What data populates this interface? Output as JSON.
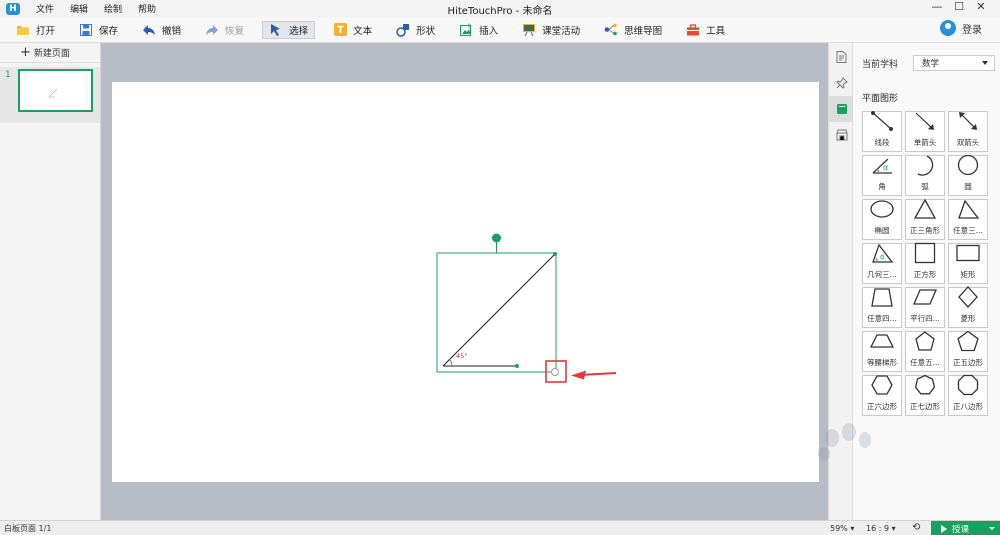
{
  "titlebar": {
    "title": "HiteTouchPro - 未命名",
    "menu": [
      "文件",
      "编辑",
      "绘制",
      "帮助"
    ]
  },
  "toolbar": {
    "open": "打开",
    "save": "保存",
    "undo": "撤销",
    "redo": "恢复",
    "select": "选择",
    "text": "文本",
    "shape": "形状",
    "insert": "插入",
    "class_activity": "课堂活动",
    "mindmap": "思维导图",
    "tools": "工具",
    "login": "登录"
  },
  "pages_panel": {
    "new_page": "新建页面",
    "page_number": "1"
  },
  "canvas": {
    "angle_label": "45°"
  },
  "right_panel": {
    "subject_label": "当前学科",
    "subject_value": "数学",
    "section_title": "平面图形",
    "shapes": [
      {
        "label": "线段",
        "icon": "line-segment-icon"
      },
      {
        "label": "单箭头",
        "icon": "single-arrow-icon"
      },
      {
        "label": "双箭头",
        "icon": "double-arrow-icon"
      },
      {
        "label": "角",
        "icon": "angle-icon"
      },
      {
        "label": "弧",
        "icon": "arc-icon"
      },
      {
        "label": "圆",
        "icon": "circle-icon"
      },
      {
        "label": "椭圆",
        "icon": "ellipse-icon"
      },
      {
        "label": "正三角形",
        "icon": "equilateral-triangle-icon"
      },
      {
        "label": "任意三...",
        "icon": "arbitrary-triangle-icon"
      },
      {
        "label": "几何三...",
        "icon": "geometric-triangle-icon"
      },
      {
        "label": "正方形",
        "icon": "square-icon"
      },
      {
        "label": "矩形",
        "icon": "rectangle-icon"
      },
      {
        "label": "任意四...",
        "icon": "arbitrary-quadrilateral-icon"
      },
      {
        "label": "平行四...",
        "icon": "parallelogram-icon"
      },
      {
        "label": "菱形",
        "icon": "rhombus-icon"
      },
      {
        "label": "等腰梯形",
        "icon": "isosceles-trapezoid-icon"
      },
      {
        "label": "任意五...",
        "icon": "arbitrary-pentagon-icon"
      },
      {
        "label": "正五边形",
        "icon": "regular-pentagon-icon"
      },
      {
        "label": "正六边形",
        "icon": "regular-hexagon-icon"
      },
      {
        "label": "正七边形",
        "icon": "regular-heptagon-icon"
      },
      {
        "label": "正八边形",
        "icon": "regular-octagon-icon"
      }
    ]
  },
  "statusbar": {
    "page_info": "白板页面 1/1",
    "zoom": "59%",
    "ratio": "16 : 9",
    "lecture": "授课"
  },
  "colors": {
    "accent_green": "#19a05e",
    "annotation_red": "#e03a3a",
    "canvas_bg": "#b8bcc6"
  }
}
